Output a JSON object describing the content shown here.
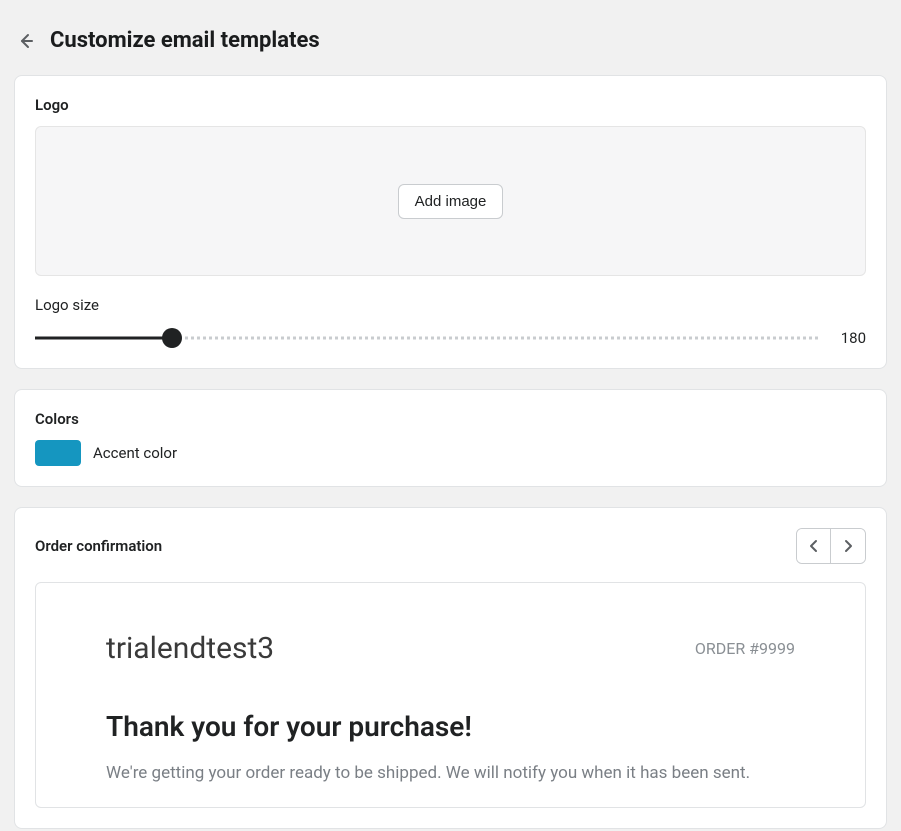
{
  "header": {
    "title": "Customize email templates"
  },
  "logo_section": {
    "label": "Logo",
    "add_image_label": "Add image",
    "size_label": "Logo size",
    "size_value": "180"
  },
  "colors_section": {
    "label": "Colors",
    "accent_label": "Accent color",
    "accent_hex": "#1596c0"
  },
  "preview_section": {
    "title": "Order confirmation",
    "store_name": "trialendtest3",
    "order_number": "ORDER #9999",
    "heading": "Thank you for your purchase!",
    "body": "We're getting your order ready to be shipped. We will notify you when it has been sent."
  }
}
